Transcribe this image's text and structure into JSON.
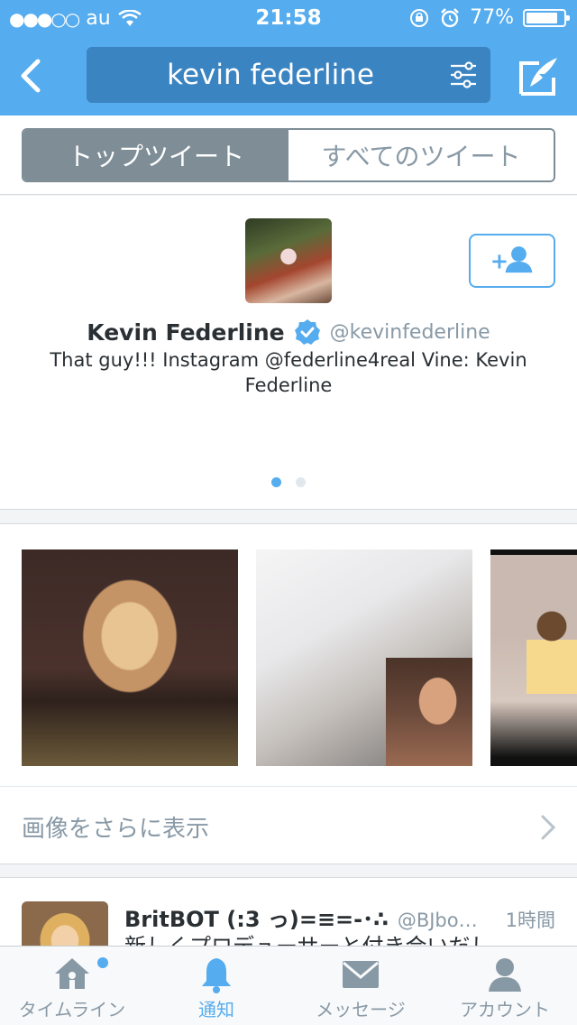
{
  "status_bar": {
    "carrier": "au",
    "time": "21:58",
    "battery": "77%"
  },
  "header": {
    "search_query": "kevin federline"
  },
  "segments": {
    "top": "トップツイート",
    "all": "すべてのツイート"
  },
  "profile": {
    "name": "Kevin Federline",
    "handle": "@kevinfederline",
    "bio": "That guy!!! Instagram @federline4real Vine: Kevin Federline",
    "page_count": 2,
    "current_page": 1
  },
  "media": {
    "more_label": "画像をさらに表示"
  },
  "tweet": {
    "name": "BritBOT (:3 っ)=≡=-･∴",
    "handle": "@BJbo…",
    "time": "1時間",
    "text": "新しくプロデューサーと付き合いだし"
  },
  "tabbar": {
    "home": "タイムライン",
    "notifications": "通知",
    "messages": "メッセージ",
    "account": "アカウント"
  },
  "colors": {
    "brand": "#55acee",
    "segment_active": "#7e8d96"
  }
}
